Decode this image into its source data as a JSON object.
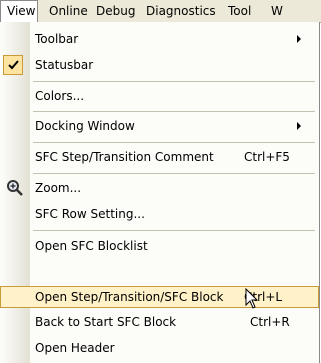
{
  "menubar": {
    "items": [
      {
        "label": "View"
      },
      {
        "label": "Online"
      },
      {
        "label": "Debug"
      },
      {
        "label": "Diagnostics"
      },
      {
        "label": "Tool"
      },
      {
        "label": "W"
      }
    ]
  },
  "menu": {
    "items": [
      {
        "label": "Toolbar",
        "submenu": true
      },
      {
        "label": "Statusbar",
        "checked": true
      },
      {
        "label": "Colors..."
      },
      {
        "label": "Docking Window",
        "submenu": true
      },
      {
        "label": "SFC Step/Transition Comment",
        "shortcut": "Ctrl+F5"
      },
      {
        "label": "Zoom...",
        "icon": "zoom-icon"
      },
      {
        "label": "SFC Row Setting..."
      },
      {
        "label": "Open SFC Blocklist"
      },
      {
        "label": "Open Step/Transition/SFC Block",
        "shortcut": "Ctrl+L",
        "highlighted": true
      },
      {
        "label": "Back to Start SFC Block",
        "shortcut": "Ctrl+R"
      },
      {
        "label": "Open Header"
      }
    ]
  },
  "colors": {
    "menubar_bg": "#ece9d8",
    "highlight_bg": "#fff2c8",
    "highlight_border": "#c99a38",
    "checked_bg": "#ffe3a0"
  }
}
